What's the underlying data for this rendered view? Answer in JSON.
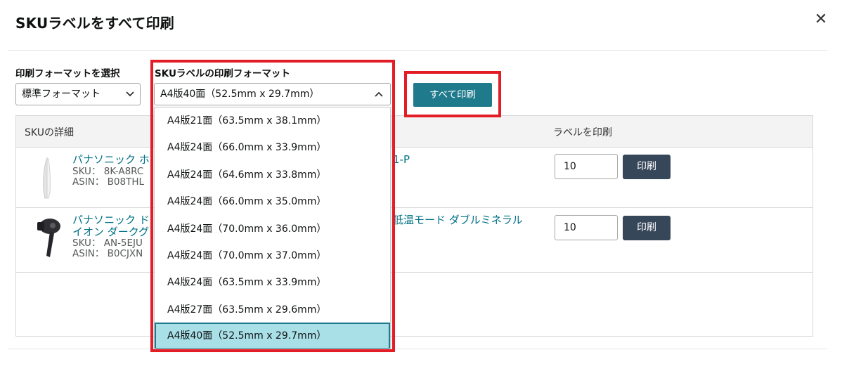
{
  "modal": {
    "title": "SKUラベルをすべて印刷",
    "close_icon": "close-icon"
  },
  "format_select": {
    "label": "印刷フォーマットを選択",
    "value": "標準フォーマット"
  },
  "sku_format_select": {
    "label": "SKUラベルの印刷フォーマット",
    "value": "A4版40面（52.5mm x 29.7mm）",
    "expanded": true,
    "options": [
      "A4版21面（63.5mm x 38.1mm）",
      "A4版24面（66.0mm x 33.9mm）",
      "A4版24面（64.6mm x 33.8mm）",
      "A4版24面（66.0mm x 35.0mm）",
      "A4版24面（70.0mm x 36.0mm）",
      "A4版24面（70.0mm x 37.0mm）",
      "A4版24面（63.5mm x 33.9mm）",
      "A4版27面（63.5mm x 29.6mm）",
      "A4版40面（52.5mm x 29.7mm）"
    ],
    "selected_index": 8
  },
  "print_all_button": "すべて印刷",
  "table": {
    "headers": {
      "details": "SKUの詳細",
      "print_labels": "ラベルを印刷"
    },
    "rows": [
      {
        "name": "パナソニック ホ",
        "name_tail": "1-P",
        "sku": "SKU： 8K-A8RC",
        "asin": "ASIN： B08THL",
        "qty": "10",
        "print_label": "印刷",
        "thumb_icon": "hair-iron-icon"
      },
      {
        "name": "パナソニック ド",
        "name_tail": "低温モード ダブルミネラル",
        "name_line2": "イオン ダークグ",
        "sku": "SKU： AN-5EJU",
        "asin": "ASIN： B0CJXN",
        "qty": "10",
        "print_label": "印刷",
        "thumb_icon": "hair-dryer-icon"
      }
    ]
  },
  "colors": {
    "primary_button": "#1f7a8c",
    "row_button": "#37475a",
    "link": "#007185",
    "highlight_border": "#e31d25",
    "selected_option_bg": "#a9e0e8"
  }
}
